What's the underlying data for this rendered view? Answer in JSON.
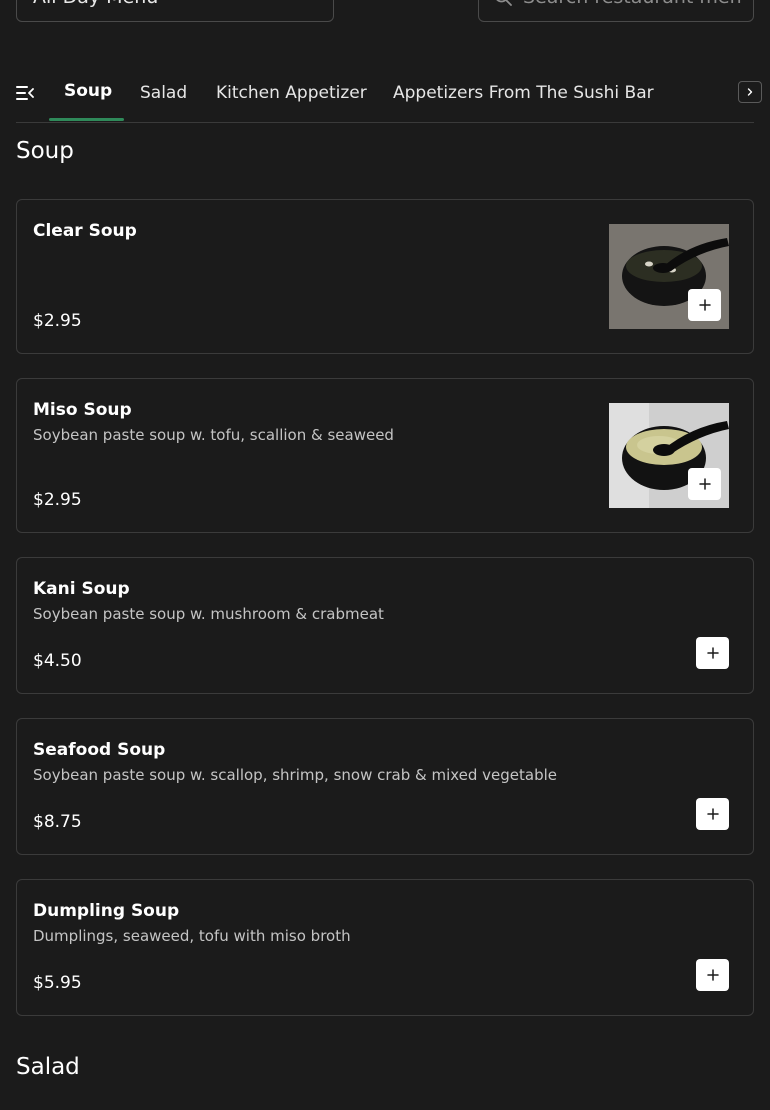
{
  "header": {
    "menu_select_value": "All Day Menu",
    "search_placeholder": "Search restaurant menu"
  },
  "tabs": [
    {
      "label": "Soup",
      "active": true
    },
    {
      "label": "Salad",
      "active": false
    },
    {
      "label": "Kitchen Appetizer",
      "active": false
    },
    {
      "label": "Appetizers From The Sushi Bar",
      "active": false
    }
  ],
  "sections": [
    {
      "title": "Soup",
      "items": [
        {
          "name": "Clear Soup",
          "description": "",
          "price": "$2.95",
          "has_image": true
        },
        {
          "name": "Miso Soup",
          "description": "Soybean paste soup w. tofu, scallion & seaweed",
          "price": "$2.95",
          "has_image": true
        },
        {
          "name": "Kani Soup",
          "description": "Soybean paste soup w. mushroom & crabmeat",
          "price": "$4.50",
          "has_image": false
        },
        {
          "name": "Seafood Soup",
          "description": "Soybean paste soup w. scallop, shrimp, snow crab & mixed vegetable",
          "price": "$8.75",
          "has_image": false
        },
        {
          "name": "Dumpling Soup",
          "description": "Dumplings, seaweed, tofu with miso broth",
          "price": "$5.95",
          "has_image": false
        }
      ]
    },
    {
      "title": "Salad",
      "items": []
    }
  ],
  "icons": {
    "menu_select": "chevron-down-icon",
    "search": "search-icon",
    "tabs_left": "collapse-menu-icon",
    "tabs_right": "chevron-right-icon",
    "add": "plus-icon"
  },
  "colors": {
    "background": "#1b1b1b",
    "active_tab_underline": "#2f8a5a",
    "card_border": "#3b3b3b",
    "add_button": "#ffffff"
  }
}
